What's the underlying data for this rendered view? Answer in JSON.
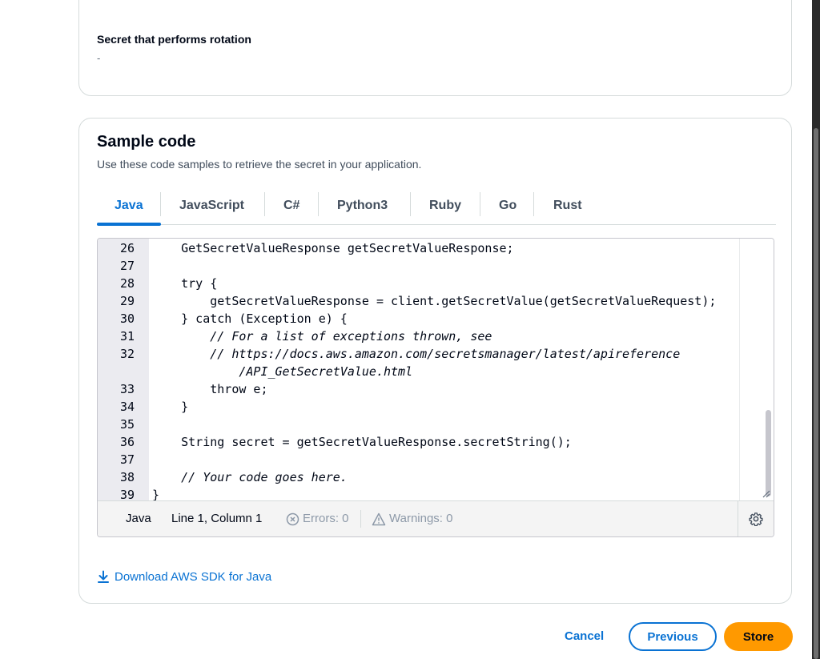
{
  "rotation_card": {
    "label": "Secret that performs rotation",
    "value": "-"
  },
  "sample_code": {
    "title": "Sample code",
    "description": "Use these code samples to retrieve the secret in your application.",
    "tabs": [
      {
        "label": "Java",
        "active": true
      },
      {
        "label": "JavaScript",
        "active": false
      },
      {
        "label": "C#",
        "active": false
      },
      {
        "label": "Python3",
        "active": false
      },
      {
        "label": "Ruby",
        "active": false
      },
      {
        "label": "Go",
        "active": false
      },
      {
        "label": "Rust",
        "active": false
      }
    ],
    "code_lines": [
      {
        "num": "26",
        "text": "    GetSecretValueResponse getSecretValueResponse;",
        "comment": false
      },
      {
        "num": "27",
        "text": "",
        "comment": false
      },
      {
        "num": "28",
        "text": "    try {",
        "comment": false
      },
      {
        "num": "29",
        "text": "        getSecretValueResponse = client.getSecretValue(getSecretValueRequest);",
        "comment": false
      },
      {
        "num": "30",
        "text": "    } catch (Exception e) {",
        "comment": false
      },
      {
        "num": "31",
        "text": "        // For a list of exceptions thrown, see",
        "comment": true
      },
      {
        "num": "32",
        "text": "        // https://docs.aws.amazon.com/secretsmanager/latest/apireference",
        "comment": true
      },
      {
        "num": "",
        "text": "            /API_GetSecretValue.html",
        "comment": true
      },
      {
        "num": "33",
        "text": "        throw e;",
        "comment": false
      },
      {
        "num": "34",
        "text": "    }",
        "comment": false
      },
      {
        "num": "35",
        "text": "",
        "comment": false
      },
      {
        "num": "36",
        "text": "    String secret = getSecretValueResponse.secretString();",
        "comment": false
      },
      {
        "num": "37",
        "text": "",
        "comment": false
      },
      {
        "num": "38",
        "text": "    // Your code goes here.",
        "comment": true
      },
      {
        "num": "39",
        "text": "}",
        "comment": false
      }
    ],
    "status": {
      "language": "Java",
      "position": "Line 1, Column 1",
      "errors": "Errors: 0",
      "warnings": "Warnings: 0"
    },
    "download_link": "Download AWS SDK for Java"
  },
  "actions": {
    "cancel": "Cancel",
    "previous": "Previous",
    "store": "Store"
  },
  "colors": {
    "accent": "#0972d3",
    "primary_button": "#ff9900"
  }
}
